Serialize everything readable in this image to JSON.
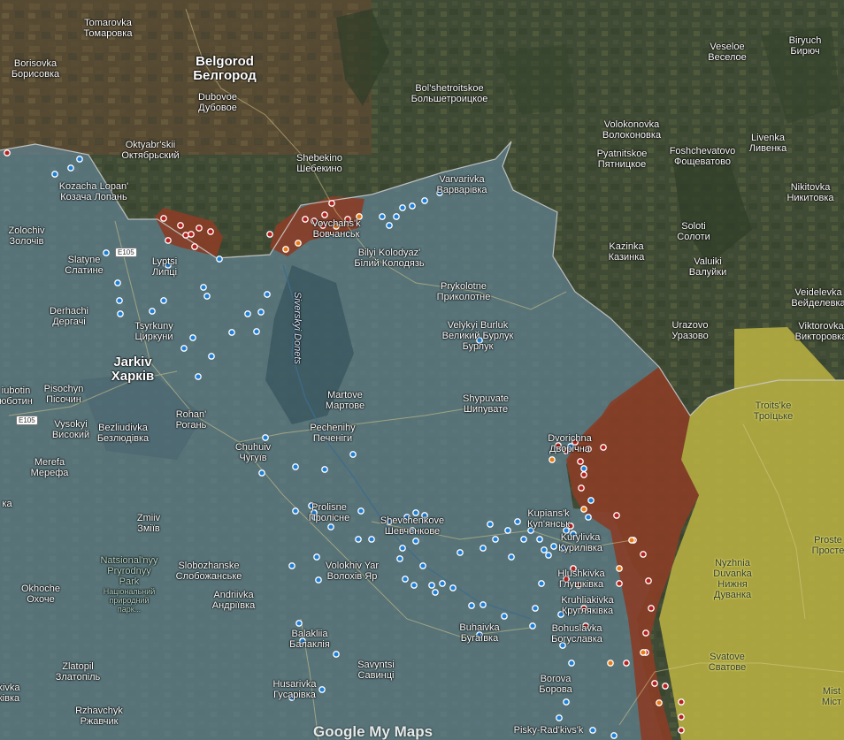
{
  "map": {
    "colors": {
      "terrain": "#3e4a34",
      "ukraine_controlled": "#5f7f8c",
      "occupied": "#8a3d26",
      "zone_yellow": "#b8b042",
      "border": "#c9c9c9",
      "marker_white": "#ffffff",
      "marker_blue": "#1e7fd8",
      "marker_red": "#b7211f",
      "marker_orange": "#ea7a14"
    },
    "watermark": "Google My Maps",
    "road_signs": [
      {
        "id": "e105-north",
        "text": "E105"
      },
      {
        "id": "e105-south",
        "text": "E105"
      }
    ],
    "river_label": "Siverskyi Donets",
    "places": [
      {
        "id": "tomarovka",
        "latin": "Tomarovka",
        "cyrillic": "Томаровка"
      },
      {
        "id": "borisovka",
        "latin": "Borisovka",
        "cyrillic": "Борисовка"
      },
      {
        "id": "belgorod",
        "latin": "Belgorod",
        "cyrillic": "Белгород",
        "big": true
      },
      {
        "id": "dubovoe",
        "latin": "Dubovoe",
        "cyrillic": "Дубовое"
      },
      {
        "id": "bolshetroitskoe",
        "latin": "Bol'shetroitskoe",
        "cyrillic": "Большетроицкое"
      },
      {
        "id": "veseloe",
        "latin": "Veseloe",
        "cyrillic": "Веселое"
      },
      {
        "id": "biryuch",
        "latin": "Biryuch",
        "cyrillic": "Бирюч"
      },
      {
        "id": "oktyabrskii",
        "latin": "Oktyabr'skii",
        "cyrillic": "Октябрьский"
      },
      {
        "id": "shebekino",
        "latin": "Shebekino",
        "cyrillic": "Шебекино"
      },
      {
        "id": "volokonovka",
        "latin": "Volokonovka",
        "cyrillic": "Волоконовка"
      },
      {
        "id": "pyatnitskoe",
        "latin": "Pyatnitskoe",
        "cyrillic": "Пятницкое"
      },
      {
        "id": "foshchevatovo",
        "latin": "Foshchevatovo",
        "cyrillic": "Фощеватово"
      },
      {
        "id": "livenka",
        "latin": "Livenka",
        "cyrillic": "Ливенка"
      },
      {
        "id": "kozacha-lopan",
        "latin": "Kozacha Lopan'",
        "cyrillic": "Козача Лопань"
      },
      {
        "id": "varvarivka",
        "latin": "Varvarivka",
        "cyrillic": "Варварівка"
      },
      {
        "id": "nikitovka",
        "latin": "Nikitovka",
        "cyrillic": "Никитовка"
      },
      {
        "id": "zolochiv",
        "latin": "Zolochiv",
        "cyrillic": "Золочів"
      },
      {
        "id": "vovchansk",
        "latin": "Vovchans'k",
        "cyrillic": "Вовчанськ"
      },
      {
        "id": "soloti",
        "latin": "Soloti",
        "cyrillic": "Солоти"
      },
      {
        "id": "kazinka",
        "latin": "Kazinka",
        "cyrillic": "Казинка"
      },
      {
        "id": "slatyne",
        "latin": "Slatyne",
        "cyrillic": "Слатине"
      },
      {
        "id": "lyptsi",
        "latin": "Lyptsi",
        "cyrillic": "Липці"
      },
      {
        "id": "bilyi-kolodyaz",
        "latin": "Bilyi Kolodyaz'",
        "cyrillic": "Білий Колодязь"
      },
      {
        "id": "valuiki",
        "latin": "Valuiki",
        "cyrillic": "Валуйки"
      },
      {
        "id": "prykolotne",
        "latin": "Prykolotne",
        "cyrillic": "Приколотне"
      },
      {
        "id": "veidelevka",
        "latin": "Veidelevka",
        "cyrillic": "Вейделевка"
      },
      {
        "id": "derhachi",
        "latin": "Derhachi",
        "cyrillic": "Дергачі"
      },
      {
        "id": "tsyrkuny",
        "latin": "Tsyrkuny",
        "cyrillic": "Циркуни"
      },
      {
        "id": "velykyi-burluk",
        "latin": "Velykyi Burluk",
        "cyrillic": "Великий Бурлук"
      },
      {
        "id": "urazovo",
        "latin": "Urazovo",
        "cyrillic": "Уразово"
      },
      {
        "id": "viktorovka",
        "latin": "Viktorovka",
        "cyrillic": "Викторовка"
      },
      {
        "id": "kharkiv",
        "latin": "Jarkiv",
        "cyrillic": "Харків",
        "big": true
      },
      {
        "id": "liubotin",
        "latin": "iubotin",
        "cyrillic": "юботин"
      },
      {
        "id": "pisochyn",
        "latin": "Pisochyn",
        "cyrillic": "Пісочин"
      },
      {
        "id": "martove",
        "latin": "Martove",
        "cyrillic": "Мартове"
      },
      {
        "id": "shypuvate",
        "latin": "Shypuvate",
        "cyrillic": "Шипувате"
      },
      {
        "id": "troitske",
        "latin": "Troits'ke",
        "cyrillic": "Троїцьке",
        "dark": true
      },
      {
        "id": "rohan",
        "latin": "Rohan'",
        "cyrillic": "Рогань"
      },
      {
        "id": "vysokyi",
        "latin": "Vysokyi",
        "cyrillic": "Високий"
      },
      {
        "id": "bezliudivka",
        "latin": "Bezliudivka",
        "cyrillic": "Безлюдівка"
      },
      {
        "id": "pechenihy",
        "latin": "Pechenihy",
        "cyrillic": "Печеніги"
      },
      {
        "id": "dvorichna",
        "latin": "Dvorichna",
        "cyrillic": "Дворічна"
      },
      {
        "id": "chuhuiv",
        "latin": "Chuhuiv",
        "cyrillic": "Чугуїв"
      },
      {
        "id": "merefa",
        "latin": "Merefa",
        "cyrillic": "Мерефа"
      },
      {
        "id": "prolisne",
        "latin": "Prolisne",
        "cyrillic": "Пролісне"
      },
      {
        "id": "shevchenkove",
        "latin": "Shevchenkove",
        "cyrillic": "Шевченкове"
      },
      {
        "id": "kupiansk",
        "latin": "Kupians'k",
        "cyrillic": "Куп'янськ"
      },
      {
        "id": "zmiiv",
        "latin": "Zmiiv",
        "cyrillic": "Зміїв"
      },
      {
        "id": "kurylivka",
        "latin": "Kurylivka",
        "cyrillic": "Курилівка"
      },
      {
        "id": "prostore",
        "latin": "Proste",
        "cyrillic": "Просте",
        "dark": true
      },
      {
        "id": "slobozhanske",
        "latin": "Slobozhanske",
        "cyrillic": "Слобожанське"
      },
      {
        "id": "volokhiv-yar",
        "latin": "Volokhiv Yar",
        "cyrillic": "Волохів Яр"
      },
      {
        "id": "nyzhnia-duvanka",
        "latin": "Nyzhnia Duvanka",
        "cyrillic": "Нижня Дуванка",
        "dark": true
      },
      {
        "id": "hlushkivka",
        "latin": "Hlushkivka",
        "cyrillic": "Глушківка"
      },
      {
        "id": "okhoche",
        "latin": "Okhoche",
        "cyrillic": "Охоче"
      },
      {
        "id": "andriivka",
        "latin": "Andriivka",
        "cyrillic": "Андріївка"
      },
      {
        "id": "krugliakivka",
        "latin": "Kruhliakivka",
        "cyrillic": "Кругляківка"
      },
      {
        "id": "buhaivka",
        "latin": "Buhaivka",
        "cyrillic": "Бугаївка"
      },
      {
        "id": "bohuslavka",
        "latin": "Bohuslavka",
        "cyrillic": "Богуславка"
      },
      {
        "id": "balakliia",
        "latin": "Balakliia",
        "cyrillic": "Балаклія"
      },
      {
        "id": "zlatopil",
        "latin": "Zlatopil",
        "cyrillic": "Златопіль"
      },
      {
        "id": "savyntsi",
        "latin": "Savyntsi",
        "cyrillic": "Савинці"
      },
      {
        "id": "svatove",
        "latin": "Svatove",
        "cyrillic": "Сватове",
        "dark": true
      },
      {
        "id": "borova",
        "latin": "Borova",
        "cyrillic": "Борова"
      },
      {
        "id": "husarivka",
        "latin": "Husarivka",
        "cyrillic": "Гусарівка"
      },
      {
        "id": "mist",
        "latin": "Mist",
        "cyrillic": "Міст",
        "dark": true
      },
      {
        "id": "rzhavchyk",
        "latin": "Rzhavchyk",
        "cyrillic": "Ржавчик"
      },
      {
        "id": "pisky-radkivski",
        "latin": "Pisky-Rad'kivs'k",
        "cyrillic": ""
      },
      {
        "id": "edge-kivka",
        "latin": "kivka",
        "cyrillic": "ківка"
      },
      {
        "id": "edge-w",
        "latin": "",
        "cyrillic": "ка"
      }
    ],
    "park": {
      "line1": "Natsional'nyy",
      "line2": "Pryrodnyy",
      "line3": "Park",
      "small1": "Національний",
      "small2": "природний",
      "small3": "парк..."
    }
  }
}
